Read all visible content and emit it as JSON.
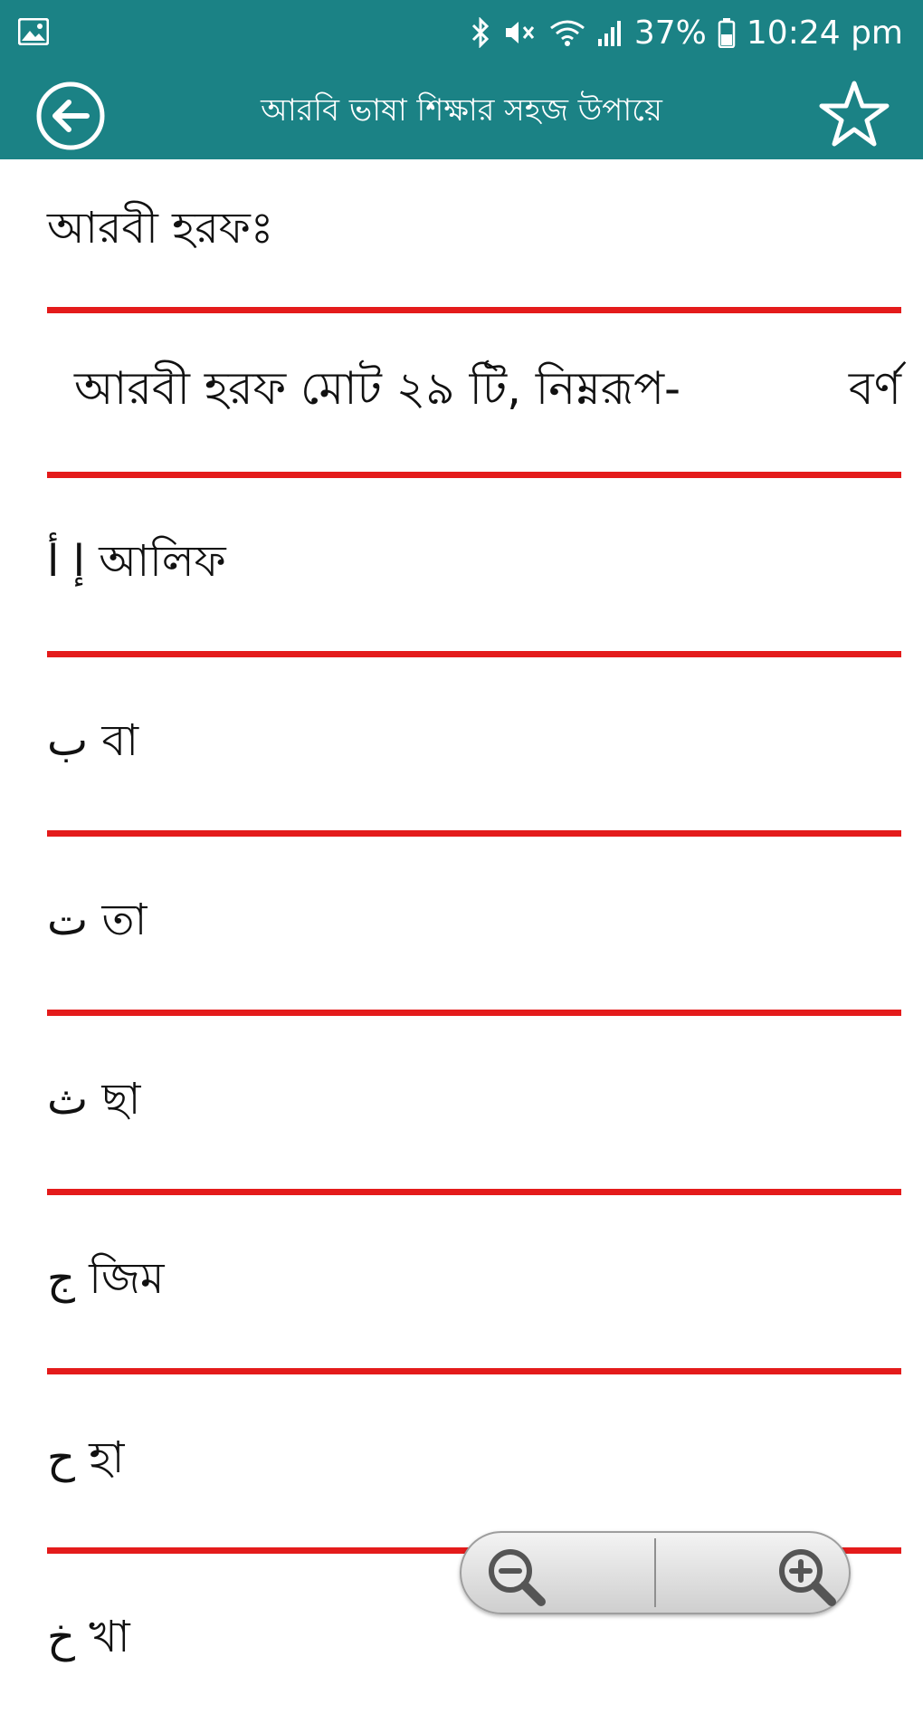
{
  "status_bar": {
    "battery": "37%",
    "time": "10:24 pm",
    "icons": [
      "gallery-icon",
      "bluetooth-icon",
      "mute-icon",
      "wifi-icon",
      "signal-icon",
      "battery-icon"
    ]
  },
  "app_bar": {
    "title": "আরবি ভাষা শিক্ষার সহজ উপায়ে",
    "icons": [
      "back-arrow-icon",
      "star-icon"
    ]
  },
  "content": {
    "heading": "আরবী হরফঃ",
    "intro": "আরবী হরফ মোট ২৯ টি, নিম্নরূপ-",
    "intro_suffix": "বর্ণ",
    "letters": [
      {
        "text": "إ أ আলিফ"
      },
      {
        "text": "ب বা"
      },
      {
        "text": "ت তা"
      },
      {
        "text": "ث ছা"
      },
      {
        "text": "ج জিম"
      },
      {
        "text": "ح হা"
      },
      {
        "text": "خ খা"
      }
    ]
  },
  "zoom_controls": {
    "icons": [
      "zoom-out-icon",
      "zoom-in-icon"
    ]
  },
  "colors": {
    "toolbar": "#1b8285",
    "divider": "#e41b1b",
    "text": "#111111",
    "background": "#ffffff"
  }
}
